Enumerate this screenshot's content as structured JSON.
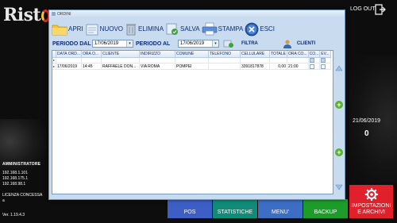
{
  "app": {
    "logo_text": "Rist",
    "logout_label": "LOG OUT",
    "operator_title": "AMMINISTRATORE",
    "ip_addresses": [
      "192.168.1.101",
      "192.168.175.1",
      "192.168.98.1"
    ],
    "license_label": "LICENZA CONCESSA",
    "license_value": "a",
    "version": "Ver. 1.19.4.3",
    "current_date": "21/06/2019",
    "count": "0"
  },
  "bottom_buttons": {
    "pos": "POS",
    "statistiche": "STATISTICHE",
    "menu": "MENU'",
    "backup": "BACKUP",
    "impostazioni_1": "IMPOSTAZIONI",
    "impostazioni_2": "E ARCHIVI"
  },
  "dialog": {
    "title": "ORDINI",
    "toolbar": {
      "apri": "APRI",
      "nuovo": "NUOVO",
      "elimina": "ELIMINA",
      "salva": "SALVA",
      "stampa": "STAMPA",
      "esci": "ESCI"
    },
    "filters": {
      "periodo_dal_label": "PERIODO DAL",
      "periodo_dal_value": "17/06/2019",
      "periodo_al_label": "PERIODO AL",
      "periodo_al_value": "17/06/2019",
      "filtra_label": "FILTRA",
      "clienti_label": "CLIENTI"
    },
    "grid": {
      "columns": [
        "DATA ORD...",
        "ORA O...",
        "CLIENTE",
        "INDIRIZZO",
        "COMUNE",
        "TELEFONO",
        "CELLULARE",
        "TOTALE",
        "ORA CO...",
        "CO...",
        "EV..."
      ],
      "rows": [
        {
          "data": "17/06/2019",
          "ora": "14:45",
          "cliente": "RAFFAELE DON...",
          "indirizzo": "VIA ROMA",
          "comune": "POMPEI",
          "telefono": "",
          "cellulare": "3391817878",
          "totale": "0,00",
          "ora_consegna": "21:00"
        }
      ]
    }
  },
  "colors": {
    "pos": "#3d5ec4",
    "statistiche": "#118a78",
    "menu": "#3d6ec4",
    "backup": "#1c9d2a",
    "impostazioni": "#e0202a",
    "dialog_bg": "#c9dcef"
  }
}
